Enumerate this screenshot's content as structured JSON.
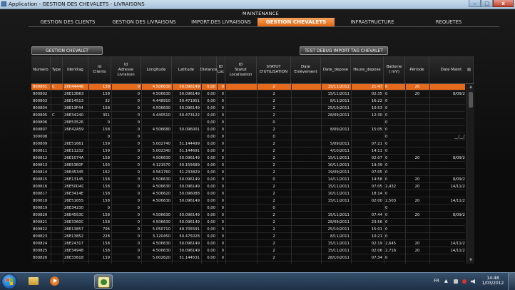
{
  "window": {
    "title": "Application - GESTION DES CHEVALETS - LIVRAISONS",
    "min": "–",
    "max": "□",
    "close": "x"
  },
  "menu_header": "MAINTENANCE",
  "nav": {
    "tabs": [
      {
        "label": "GESTION DES CLIENTS",
        "active": false
      },
      {
        "label": "GESTION DES LIVRAISONS",
        "active": false
      },
      {
        "label": "IMPORT.DES LIVRAISONS",
        "active": false
      },
      {
        "label": "GESTION CHEVALETS",
        "active": true
      },
      {
        "label": "INFRASTRUCTURE",
        "active": false
      },
      {
        "label": "REQUETES",
        "active": false
      }
    ]
  },
  "buttons": {
    "gestion_chevalet": "GESTION CHEVALET",
    "test_debug": "TEST DEBUG IMPORT TAG CHEVALET"
  },
  "table": {
    "columns": [
      "Numero",
      "Type",
      "Identtag",
      "Id\nClients",
      "Id\nAdresse\nLivraison",
      "Longitude",
      "Latitude",
      "Distance",
      "ID\nLoc",
      "ID\nStatut\nLocalisation",
      "STATUT\nD'UTILISATION",
      "Date\nEnlèvement",
      "Date_depose",
      "Heure_depose",
      "Batterie\n( mV)",
      "Période",
      "Date Maint"
    ],
    "rows": [
      [
        "800801",
        "C",
        "26E4444B",
        "158",
        "0",
        "4.506630",
        "50.096149",
        "0,00",
        "0",
        "",
        "2",
        "",
        "15/11/2011",
        "21:47",
        "0",
        "20",
        ""
      ],
      [
        "800802",
        "",
        "26E13B63",
        "158",
        "0",
        "4.506630",
        "50.096149",
        "0,00",
        "0",
        "",
        "2",
        "",
        "15/11/2011",
        "02:35",
        "0",
        "20",
        "8/09/2011"
      ],
      [
        "800803",
        "",
        "26E14513",
        "32",
        "0",
        "4.448910",
        "50.471951",
        "0,00",
        "0",
        "",
        "2",
        "",
        "8/11/2011",
        "16:22",
        "0",
        "",
        ""
      ],
      [
        "800804",
        "",
        "26E13F44",
        "158",
        "0",
        "4.506630",
        "50.096149",
        "0,00",
        "0",
        "",
        "2",
        "",
        "25/10/2011",
        "10:53",
        "0",
        "",
        ""
      ],
      [
        "800805",
        "C",
        "26E34240",
        "351",
        "0",
        "4.440510",
        "50.473122",
        "0,00",
        "0",
        "",
        "2",
        "",
        "28/09/2011",
        "12:30",
        "0",
        "",
        ""
      ],
      [
        "800806",
        "",
        "26E53526",
        "0",
        "0",
        "",
        "",
        "0,00",
        "0",
        "",
        "0",
        "",
        "",
        "",
        "0",
        "",
        ""
      ],
      [
        "800807",
        "",
        "26E42A59",
        "158",
        "0",
        "4.506680",
        "50.096001",
        "0,00",
        "0",
        "",
        "2",
        "",
        "8/09/2011",
        "15:05",
        "0",
        "",
        ""
      ],
      [
        "300008",
        "",
        "",
        "0",
        "0",
        "",
        "",
        "0,00",
        "0",
        "",
        "0",
        "",
        "",
        "",
        "0",
        "",
        "__/__/____"
      ],
      [
        "800809",
        "",
        "26E51661",
        "159",
        "0",
        "5.002740",
        "51.144499",
        "0,00",
        "0",
        "",
        "2",
        "",
        "5/09/2011",
        "07:21",
        "0",
        "",
        ""
      ],
      [
        "800811",
        "",
        "26E11232",
        "159",
        "0",
        "5.002340",
        "51.144691",
        "0,00",
        "0",
        "",
        "2",
        "",
        "4/10/2011",
        "14:11",
        "0",
        "",
        ""
      ],
      [
        "800812",
        "",
        "26E1074A",
        "158",
        "0",
        "4.506630",
        "50.096149",
        "0,00",
        "0",
        "",
        "2",
        "",
        "15/11/2011",
        "02:07",
        "0",
        "20",
        "8/09/2011"
      ],
      [
        "800813",
        "",
        "26E53E0F",
        "103",
        "0",
        "4.121570",
        "50.155689",
        "0,00",
        "0",
        "",
        "2",
        "",
        "10/11/2011",
        "19:39",
        "0",
        "",
        ""
      ],
      [
        "800814",
        "",
        "26E45345",
        "162",
        "0",
        "4.561760",
        "51.233829",
        "0,00",
        "0",
        "",
        "2",
        "",
        "19/09/2011",
        "07:05",
        "0",
        "",
        ""
      ],
      [
        "800815",
        "",
        "26E13145",
        "158",
        "0",
        "4.506630",
        "50.096149",
        "0,00",
        "0",
        "",
        "0",
        "",
        "14/11/2011",
        "14:58",
        "0",
        "20",
        "8/09/2011"
      ],
      [
        "800816",
        "",
        "26E50D4C",
        "158",
        "0",
        "4.506630",
        "50.096149",
        "0,00",
        "0",
        "",
        "2",
        "",
        "15/11/2011",
        "07:05",
        "2,432",
        "20",
        "14/11/2011"
      ],
      [
        "800817",
        "",
        "26E3414E",
        "158",
        "0",
        "4.506620",
        "50.096088",
        "0,00",
        "0",
        "",
        "2",
        "",
        "10/11/2011",
        "18:14",
        "0",
        "",
        ""
      ],
      [
        "800818",
        "",
        "26E51655",
        "158",
        "0",
        "4.506630",
        "50.096149",
        "0,00",
        "0",
        "",
        "2",
        "",
        "15/11/2011",
        "02:00",
        "2,503",
        "20",
        "14/11/2011"
      ],
      [
        "800819",
        "",
        "26E34230",
        "0",
        "0",
        "",
        "",
        "0,00",
        "0",
        "",
        "0",
        "",
        "",
        "",
        "0",
        "",
        ""
      ],
      [
        "800820",
        "",
        "26E4553C",
        "158",
        "0",
        "4.506630",
        "50.096149",
        "0,00",
        "0",
        "",
        "2",
        "",
        "15/11/2011",
        "07:44",
        "0",
        "20",
        "8/09/2011"
      ],
      [
        "800821",
        "",
        "26E3360C",
        "158",
        "0",
        "4.506630",
        "50.096149",
        "0,00",
        "0",
        "",
        "2",
        "",
        "28/09/2011",
        "23:56",
        "0",
        "",
        ""
      ],
      [
        "800822",
        "",
        "26E13857",
        "706",
        "0",
        "5.050710",
        "49.705591",
        "0,00",
        "0",
        "",
        "2",
        "",
        "25/10/2011",
        "15:01",
        "0",
        "",
        ""
      ],
      [
        "800823",
        "",
        "26E13852",
        "228",
        "0",
        "3.120450",
        "50.475028",
        "0,00",
        "0",
        "",
        "2",
        "",
        "8/11/2011",
        "10:21",
        "0",
        "",
        ""
      ],
      [
        "800824",
        "",
        "26E24317",
        "158",
        "0",
        "4.506630",
        "50.096149",
        "0,00",
        "0",
        "",
        "2",
        "",
        "15/11/2011",
        "02:19",
        "2,645",
        "20",
        "14/11/2011"
      ],
      [
        "800825",
        "",
        "26E34948",
        "158",
        "0",
        "4.506630",
        "50.096149",
        "0,00",
        "0",
        "",
        "2",
        "",
        "15/11/2011",
        "02:06",
        "2,716",
        "20",
        "14/11/2011"
      ],
      [
        "800826",
        "",
        "26E33618",
        "159",
        "0",
        "5.002620",
        "51.144531",
        "0,00",
        "0",
        "",
        "2",
        "",
        "28/10/2011",
        "07:34",
        "0",
        "",
        ""
      ]
    ]
  },
  "taskbar": {
    "lang": "FR",
    "time": "14:48",
    "date": "1/03/2012",
    "tray_arrow": "▲"
  }
}
